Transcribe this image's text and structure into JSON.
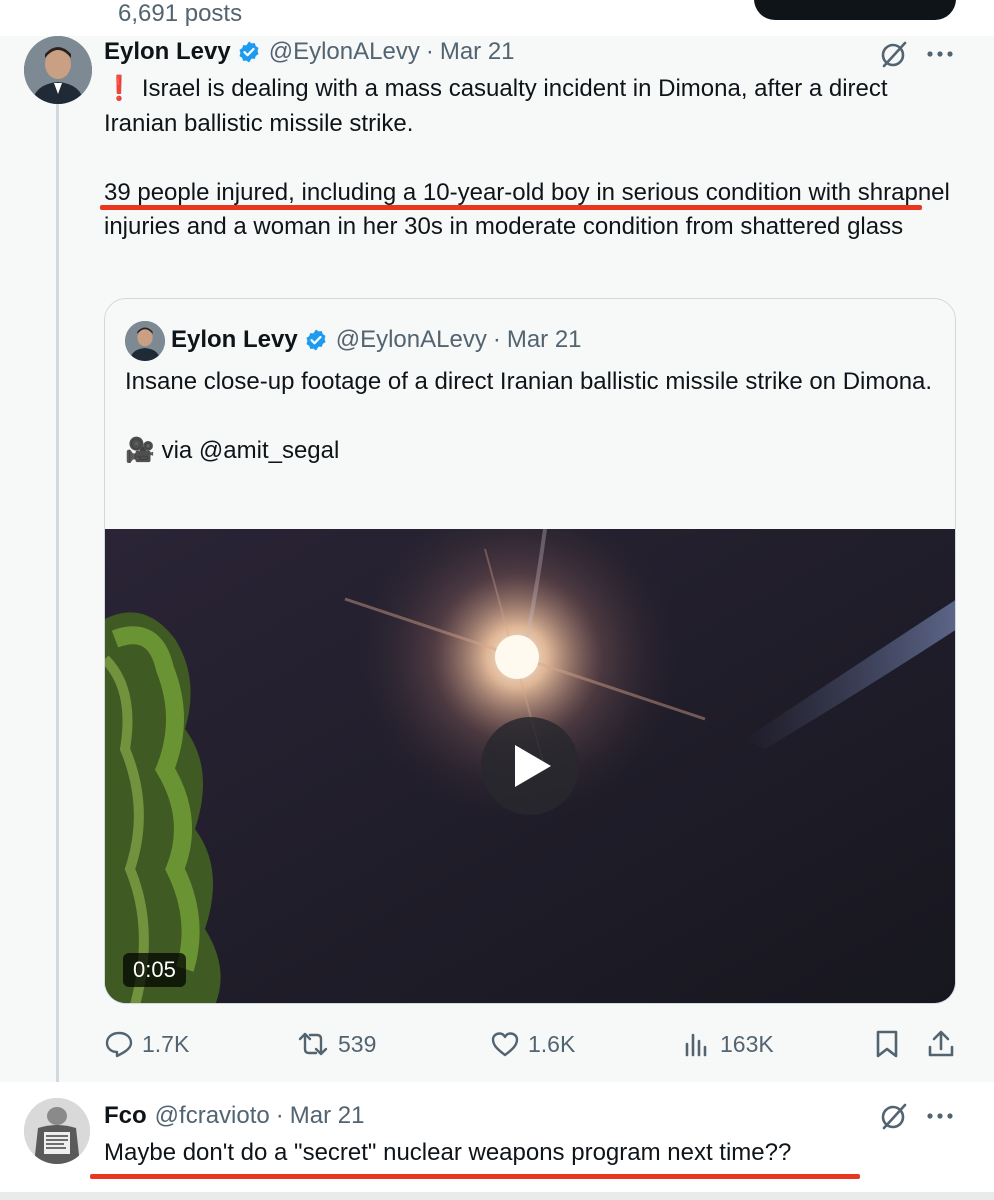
{
  "profile_header": {
    "posts_count": "6,691 posts"
  },
  "main_tweet": {
    "author_name": "Eylon Levy",
    "handle": "@EylonALevy",
    "separator": "·",
    "date": "Mar 21",
    "paragraph_1_prefix": "❗",
    "paragraph_1": "Israel is dealing with a mass casualty incident in Dimona, after a direct Iranian ballistic missile strike.",
    "paragraph_2": "39 people injured, including a 10-year-old boy in serious condition with shrapnel injuries and a woman in her 30s in moderate condition from shattered glass"
  },
  "quoted_tweet": {
    "author_name": "Eylon Levy",
    "handle": "@EylonALevy",
    "separator": "·",
    "date": "Mar 21",
    "line_1": "Insane close-up footage of a direct Iranian ballistic missile strike on Dimona.",
    "line_2_icon": "🎥",
    "line_2": "via @amit_segal",
    "video_duration": "0:05"
  },
  "actions": {
    "replies": "1.7K",
    "reposts": "539",
    "likes": "1.6K",
    "views": "163K"
  },
  "reply_tweet": {
    "author_name": "Fco",
    "handle": "@fcravioto",
    "separator": "·",
    "date": "Mar 21",
    "text": "Maybe don't do a \"secret\" nuclear weapons program next time??"
  },
  "icons": {
    "verified": "verified-badge-icon",
    "grok": "grok-icon",
    "more": "more-icon",
    "reply": "reply-icon",
    "repost": "repost-icon",
    "like": "like-icon",
    "views": "views-icon",
    "bookmark": "bookmark-icon",
    "share": "share-icon",
    "play": "play-icon"
  },
  "colors": {
    "verified_blue": "#1d9bf0",
    "annotation_red": "#e8361f",
    "muted_text": "#536471",
    "text": "#0f1419"
  }
}
